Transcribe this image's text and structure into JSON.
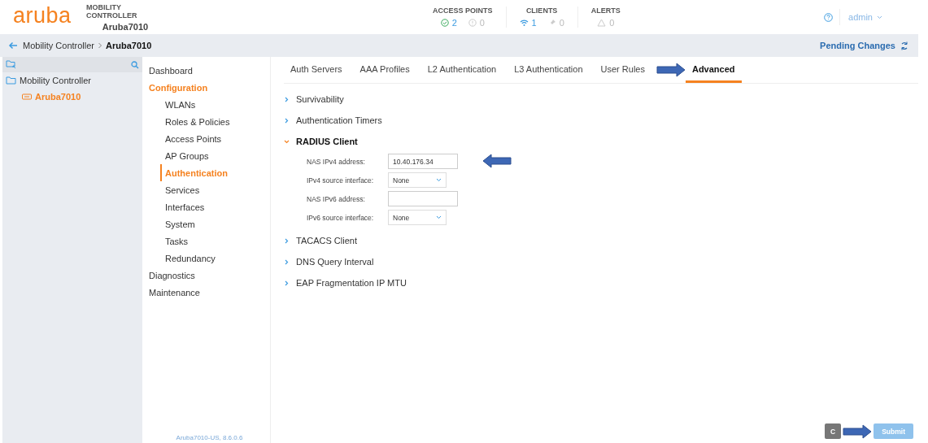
{
  "header": {
    "logo": "aruba",
    "product": "MOBILITY CONTROLLER",
    "device": "Aruba7010",
    "stats": [
      {
        "title": "ACCESS POINTS",
        "items": [
          {
            "kind": "check",
            "value": "2",
            "active": true
          },
          {
            "kind": "alert",
            "value": "0",
            "active": false
          }
        ]
      },
      {
        "title": "CLIENTS",
        "items": [
          {
            "kind": "wifi",
            "value": "1",
            "active": true
          },
          {
            "kind": "pin",
            "value": "0",
            "active": false
          }
        ]
      },
      {
        "title": "ALERTS",
        "items": [
          {
            "kind": "warning",
            "value": "0",
            "active": false
          }
        ]
      }
    ],
    "user": "admin"
  },
  "breadcrumb": {
    "items": [
      "Mobility Controller",
      "Aruba7010"
    ],
    "pending": "Pending Changes"
  },
  "tree": [
    {
      "label": "Mobility Controller",
      "kind": "folder",
      "selected": false,
      "children": [
        {
          "label": "Aruba7010",
          "kind": "device",
          "selected": true
        }
      ]
    }
  ],
  "nav": [
    {
      "label": "Dashboard",
      "selected": false
    },
    {
      "label": "Configuration",
      "selected": true,
      "children": [
        {
          "label": "WLANs",
          "selected": false
        },
        {
          "label": "Roles & Policies",
          "selected": false
        },
        {
          "label": "Access Points",
          "selected": false
        },
        {
          "label": "AP Groups",
          "selected": false
        },
        {
          "label": "Authentication",
          "selected": true
        },
        {
          "label": "Services",
          "selected": false
        },
        {
          "label": "Interfaces",
          "selected": false
        },
        {
          "label": "System",
          "selected": false
        },
        {
          "label": "Tasks",
          "selected": false
        },
        {
          "label": "Redundancy",
          "selected": false
        }
      ]
    },
    {
      "label": "Diagnostics",
      "selected": false
    },
    {
      "label": "Maintenance",
      "selected": false
    }
  ],
  "version": "Aruba7010-US, 8.6.0.6",
  "tabs": [
    {
      "label": "Auth Servers",
      "selected": false
    },
    {
      "label": "AAA Profiles",
      "selected": false
    },
    {
      "label": "L2 Authentication",
      "selected": false
    },
    {
      "label": "L3 Authentication",
      "selected": false
    },
    {
      "label": "User Rules",
      "selected": false
    },
    {
      "label": "Advanced",
      "selected": true
    }
  ],
  "sections": [
    {
      "title": "Survivability",
      "expanded": false
    },
    {
      "title": "Authentication Timers",
      "expanded": false
    },
    {
      "title": "RADIUS Client",
      "expanded": true,
      "fields": [
        {
          "label": "NAS IPv4 address:",
          "kind": "text",
          "value": "10.40.176.34"
        },
        {
          "label": "IPv4 source interface:",
          "kind": "select",
          "value": "None"
        },
        {
          "label": "NAS IPv6 address:",
          "kind": "text"
        },
        {
          "label": "IPv6 source interface:",
          "kind": "select",
          "value": "None"
        }
      ]
    },
    {
      "title": "TACACS Client",
      "expanded": false
    },
    {
      "title": "DNS Query Interval",
      "expanded": false
    },
    {
      "title": "EAP Fragmentation IP MTU",
      "expanded": false
    }
  ],
  "buttons": [
    {
      "label": "C",
      "kind": "secondary"
    },
    {
      "label": "Submit",
      "kind": "primary",
      "disabled": true
    }
  ]
}
